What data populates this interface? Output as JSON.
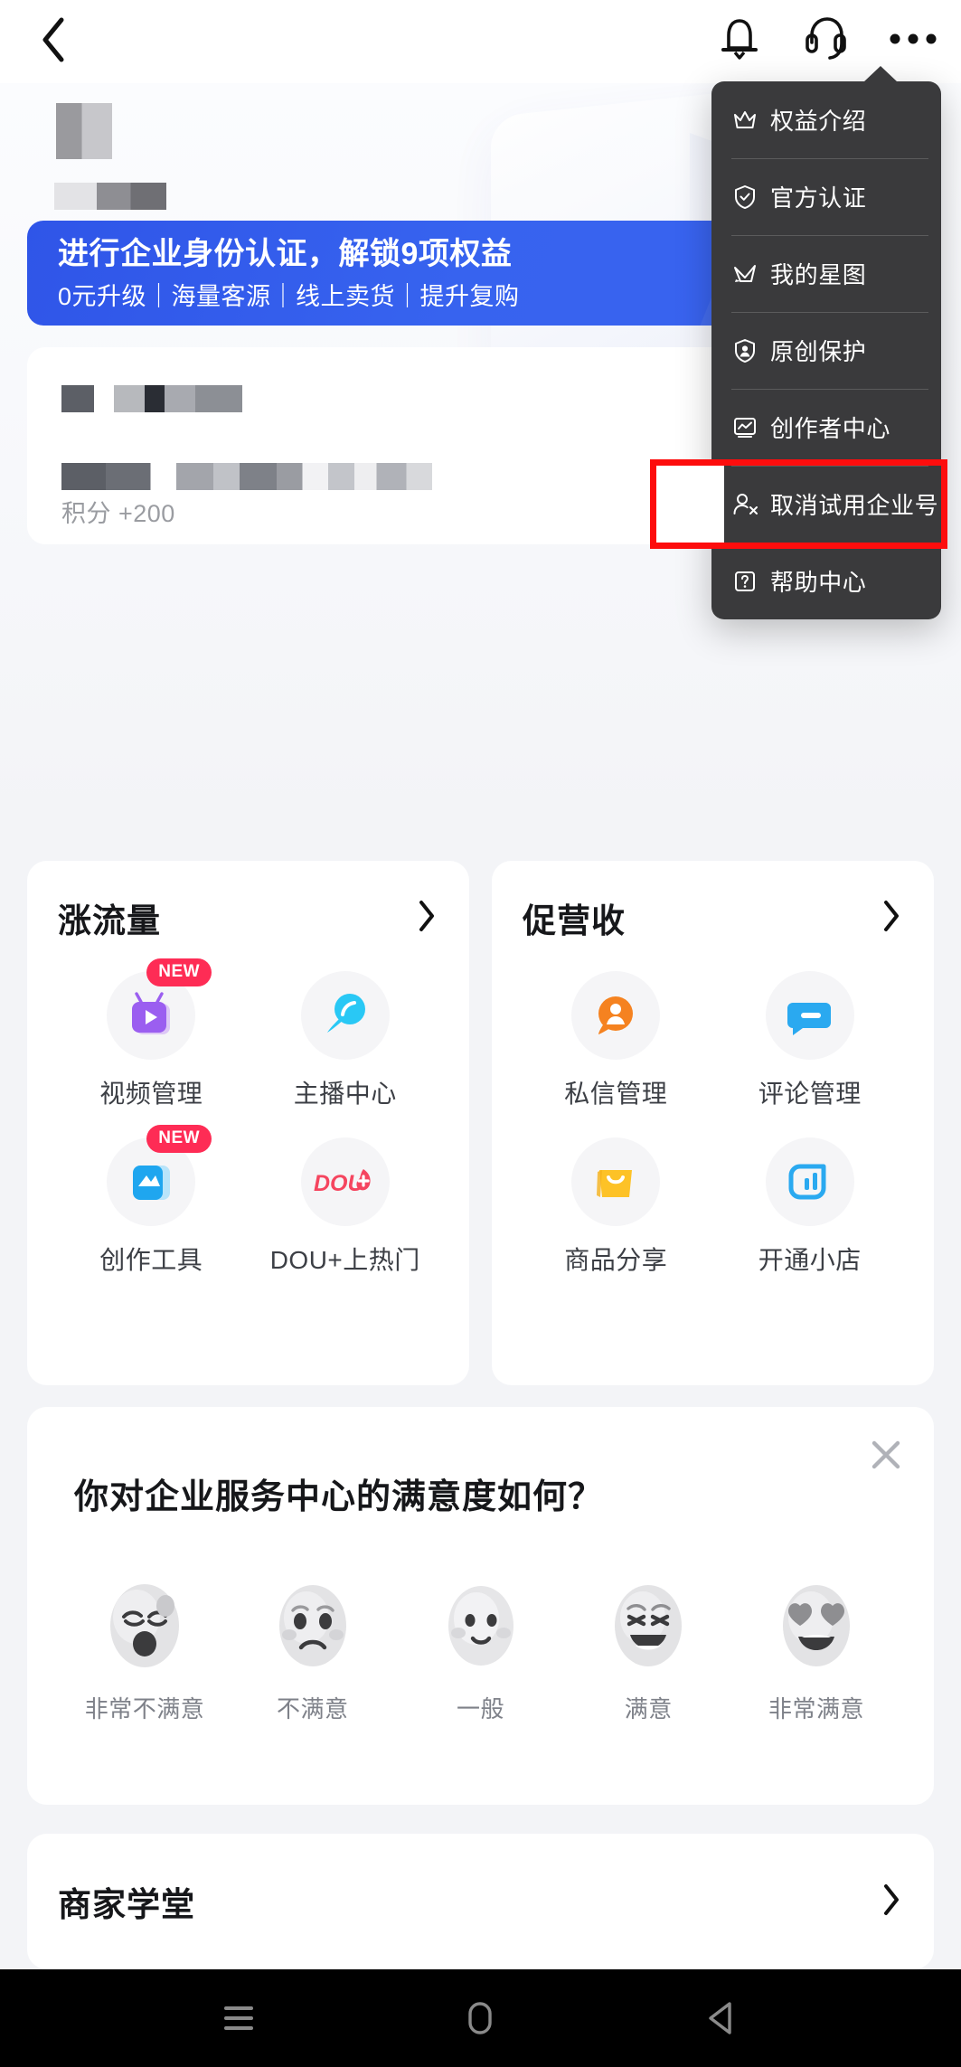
{
  "header": {
    "back_icon": "chevron-left-icon",
    "bell_icon": "bell-icon",
    "headset_icon": "headset-icon",
    "more_icon": "more-dots-icon"
  },
  "hero": {
    "banner": {
      "title": "进行企业身份认证，解锁9项权益",
      "subtitle": "0元升级｜海量客源｜线上卖货｜提升复购",
      "bg_color": "#3763ef"
    },
    "points_label": "积分 +200"
  },
  "menu": {
    "items": [
      {
        "label": "权益介绍",
        "icon": "crown-icon",
        "highlighted": false
      },
      {
        "label": "官方认证",
        "icon": "shield-check-icon",
        "highlighted": false
      },
      {
        "label": "我的星图",
        "icon": "star-map-icon",
        "highlighted": false
      },
      {
        "label": "原创保护",
        "icon": "shield-person-icon",
        "highlighted": false
      },
      {
        "label": "创作者中心",
        "icon": "monitor-chart-icon",
        "highlighted": false
      },
      {
        "label": "取消试用企业号",
        "icon": "person-remove-icon",
        "highlighted": true
      },
      {
        "label": "帮助中心",
        "icon": "question-box-icon",
        "highlighted": false
      }
    ],
    "highlight_color": "#fd0d0d",
    "bg_color": "#3a3a3c"
  },
  "feature_cards": [
    {
      "title": "涨流量",
      "chevron": "chevron-right-icon",
      "items": [
        {
          "label": "视频管理",
          "icon": "video-tv-icon",
          "badge": "NEW"
        },
        {
          "label": "主播中心",
          "icon": "live-mic-icon",
          "badge": ""
        },
        {
          "label": "创作工具",
          "icon": "creation-tool-icon",
          "badge": "NEW"
        },
        {
          "label": "DOU+上热门",
          "icon": "dou-plus-icon",
          "badge": ""
        }
      ]
    },
    {
      "title": "促营收",
      "chevron": "chevron-right-icon",
      "items": [
        {
          "label": "私信管理",
          "icon": "message-person-icon",
          "badge": ""
        },
        {
          "label": "评论管理",
          "icon": "comment-icon",
          "badge": ""
        },
        {
          "label": "商品分享",
          "icon": "shopping-bag-icon",
          "badge": ""
        },
        {
          "label": "开通小店",
          "icon": "shop-icon",
          "badge": ""
        }
      ]
    }
  ],
  "survey": {
    "question": "你对企业服务中心的满意度如何？",
    "close_icon": "close-icon",
    "options": [
      {
        "label": "非常不满意",
        "face": "very-dissatisfied-face"
      },
      {
        "label": "不满意",
        "face": "dissatisfied-face"
      },
      {
        "label": "一般",
        "face": "neutral-face"
      },
      {
        "label": "满意",
        "face": "satisfied-face"
      },
      {
        "label": "非常满意",
        "face": "very-satisfied-face"
      }
    ]
  },
  "school": {
    "title": "商家学堂",
    "chevron": "chevron-right-icon"
  },
  "navbar": {
    "recents_icon": "menu-lines-icon",
    "home_icon": "home-pill-icon",
    "back_icon": "back-triangle-icon"
  }
}
